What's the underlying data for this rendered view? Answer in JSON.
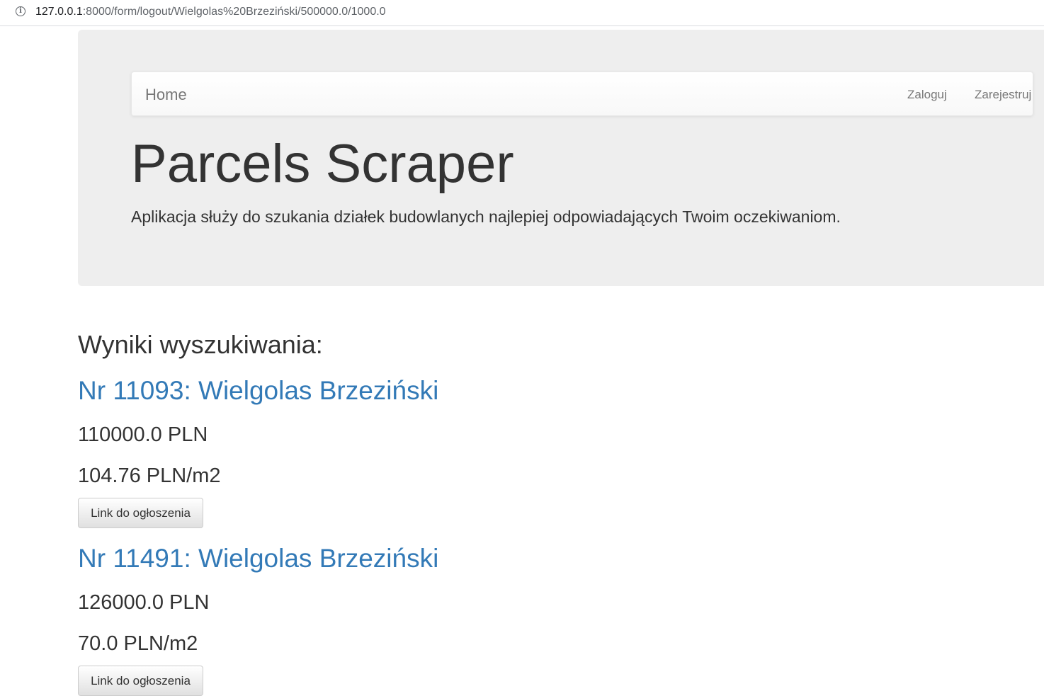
{
  "browser": {
    "url_host": "127.0.0.1",
    "url_rest": ":8000/form/logout/Wielgolas%20Brzeziński/500000.0/1000.0"
  },
  "navbar": {
    "brand": "Home",
    "login": "Zaloguj",
    "register": "Zarejestruj"
  },
  "jumbotron": {
    "title": "Parcels Scraper",
    "lead": "Aplikacja służy do szukania działek budowlanych najlepiej odpowiadających Twoim oczekiwaniom."
  },
  "results": {
    "heading": "Wyniki wyszukiwania:",
    "items": [
      {
        "title": "Nr 11093: Wielgolas Brzeziński",
        "price": "110000.0 PLN",
        "price_per_m2": "104.76 PLN/m2",
        "button": "Link do ogłoszenia"
      },
      {
        "title": "Nr 11491: Wielgolas Brzeziński",
        "price": "126000.0 PLN",
        "price_per_m2": "70.0 PLN/m2",
        "button": "Link do ogłoszenia"
      }
    ]
  }
}
